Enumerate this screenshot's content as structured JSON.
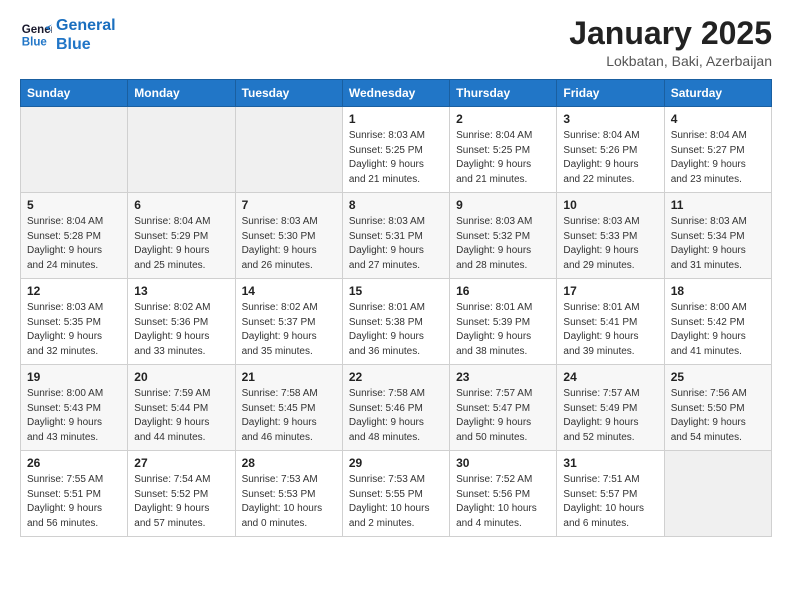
{
  "header": {
    "logo_line1": "General",
    "logo_line2": "Blue",
    "title": "January 2025",
    "subtitle": "Lokbatan, Baki, Azerbaijan"
  },
  "weekdays": [
    "Sunday",
    "Monday",
    "Tuesday",
    "Wednesday",
    "Thursday",
    "Friday",
    "Saturday"
  ],
  "weeks": [
    [
      {
        "day": "",
        "info": ""
      },
      {
        "day": "",
        "info": ""
      },
      {
        "day": "",
        "info": ""
      },
      {
        "day": "1",
        "info": "Sunrise: 8:03 AM\nSunset: 5:25 PM\nDaylight: 9 hours\nand 21 minutes."
      },
      {
        "day": "2",
        "info": "Sunrise: 8:04 AM\nSunset: 5:25 PM\nDaylight: 9 hours\nand 21 minutes."
      },
      {
        "day": "3",
        "info": "Sunrise: 8:04 AM\nSunset: 5:26 PM\nDaylight: 9 hours\nand 22 minutes."
      },
      {
        "day": "4",
        "info": "Sunrise: 8:04 AM\nSunset: 5:27 PM\nDaylight: 9 hours\nand 23 minutes."
      }
    ],
    [
      {
        "day": "5",
        "info": "Sunrise: 8:04 AM\nSunset: 5:28 PM\nDaylight: 9 hours\nand 24 minutes."
      },
      {
        "day": "6",
        "info": "Sunrise: 8:04 AM\nSunset: 5:29 PM\nDaylight: 9 hours\nand 25 minutes."
      },
      {
        "day": "7",
        "info": "Sunrise: 8:03 AM\nSunset: 5:30 PM\nDaylight: 9 hours\nand 26 minutes."
      },
      {
        "day": "8",
        "info": "Sunrise: 8:03 AM\nSunset: 5:31 PM\nDaylight: 9 hours\nand 27 minutes."
      },
      {
        "day": "9",
        "info": "Sunrise: 8:03 AM\nSunset: 5:32 PM\nDaylight: 9 hours\nand 28 minutes."
      },
      {
        "day": "10",
        "info": "Sunrise: 8:03 AM\nSunset: 5:33 PM\nDaylight: 9 hours\nand 29 minutes."
      },
      {
        "day": "11",
        "info": "Sunrise: 8:03 AM\nSunset: 5:34 PM\nDaylight: 9 hours\nand 31 minutes."
      }
    ],
    [
      {
        "day": "12",
        "info": "Sunrise: 8:03 AM\nSunset: 5:35 PM\nDaylight: 9 hours\nand 32 minutes."
      },
      {
        "day": "13",
        "info": "Sunrise: 8:02 AM\nSunset: 5:36 PM\nDaylight: 9 hours\nand 33 minutes."
      },
      {
        "day": "14",
        "info": "Sunrise: 8:02 AM\nSunset: 5:37 PM\nDaylight: 9 hours\nand 35 minutes."
      },
      {
        "day": "15",
        "info": "Sunrise: 8:01 AM\nSunset: 5:38 PM\nDaylight: 9 hours\nand 36 minutes."
      },
      {
        "day": "16",
        "info": "Sunrise: 8:01 AM\nSunset: 5:39 PM\nDaylight: 9 hours\nand 38 minutes."
      },
      {
        "day": "17",
        "info": "Sunrise: 8:01 AM\nSunset: 5:41 PM\nDaylight: 9 hours\nand 39 minutes."
      },
      {
        "day": "18",
        "info": "Sunrise: 8:00 AM\nSunset: 5:42 PM\nDaylight: 9 hours\nand 41 minutes."
      }
    ],
    [
      {
        "day": "19",
        "info": "Sunrise: 8:00 AM\nSunset: 5:43 PM\nDaylight: 9 hours\nand 43 minutes."
      },
      {
        "day": "20",
        "info": "Sunrise: 7:59 AM\nSunset: 5:44 PM\nDaylight: 9 hours\nand 44 minutes."
      },
      {
        "day": "21",
        "info": "Sunrise: 7:58 AM\nSunset: 5:45 PM\nDaylight: 9 hours\nand 46 minutes."
      },
      {
        "day": "22",
        "info": "Sunrise: 7:58 AM\nSunset: 5:46 PM\nDaylight: 9 hours\nand 48 minutes."
      },
      {
        "day": "23",
        "info": "Sunrise: 7:57 AM\nSunset: 5:47 PM\nDaylight: 9 hours\nand 50 minutes."
      },
      {
        "day": "24",
        "info": "Sunrise: 7:57 AM\nSunset: 5:49 PM\nDaylight: 9 hours\nand 52 minutes."
      },
      {
        "day": "25",
        "info": "Sunrise: 7:56 AM\nSunset: 5:50 PM\nDaylight: 9 hours\nand 54 minutes."
      }
    ],
    [
      {
        "day": "26",
        "info": "Sunrise: 7:55 AM\nSunset: 5:51 PM\nDaylight: 9 hours\nand 56 minutes."
      },
      {
        "day": "27",
        "info": "Sunrise: 7:54 AM\nSunset: 5:52 PM\nDaylight: 9 hours\nand 57 minutes."
      },
      {
        "day": "28",
        "info": "Sunrise: 7:53 AM\nSunset: 5:53 PM\nDaylight: 10 hours\nand 0 minutes."
      },
      {
        "day": "29",
        "info": "Sunrise: 7:53 AM\nSunset: 5:55 PM\nDaylight: 10 hours\nand 2 minutes."
      },
      {
        "day": "30",
        "info": "Sunrise: 7:52 AM\nSunset: 5:56 PM\nDaylight: 10 hours\nand 4 minutes."
      },
      {
        "day": "31",
        "info": "Sunrise: 7:51 AM\nSunset: 5:57 PM\nDaylight: 10 hours\nand 6 minutes."
      },
      {
        "day": "",
        "info": ""
      }
    ]
  ]
}
